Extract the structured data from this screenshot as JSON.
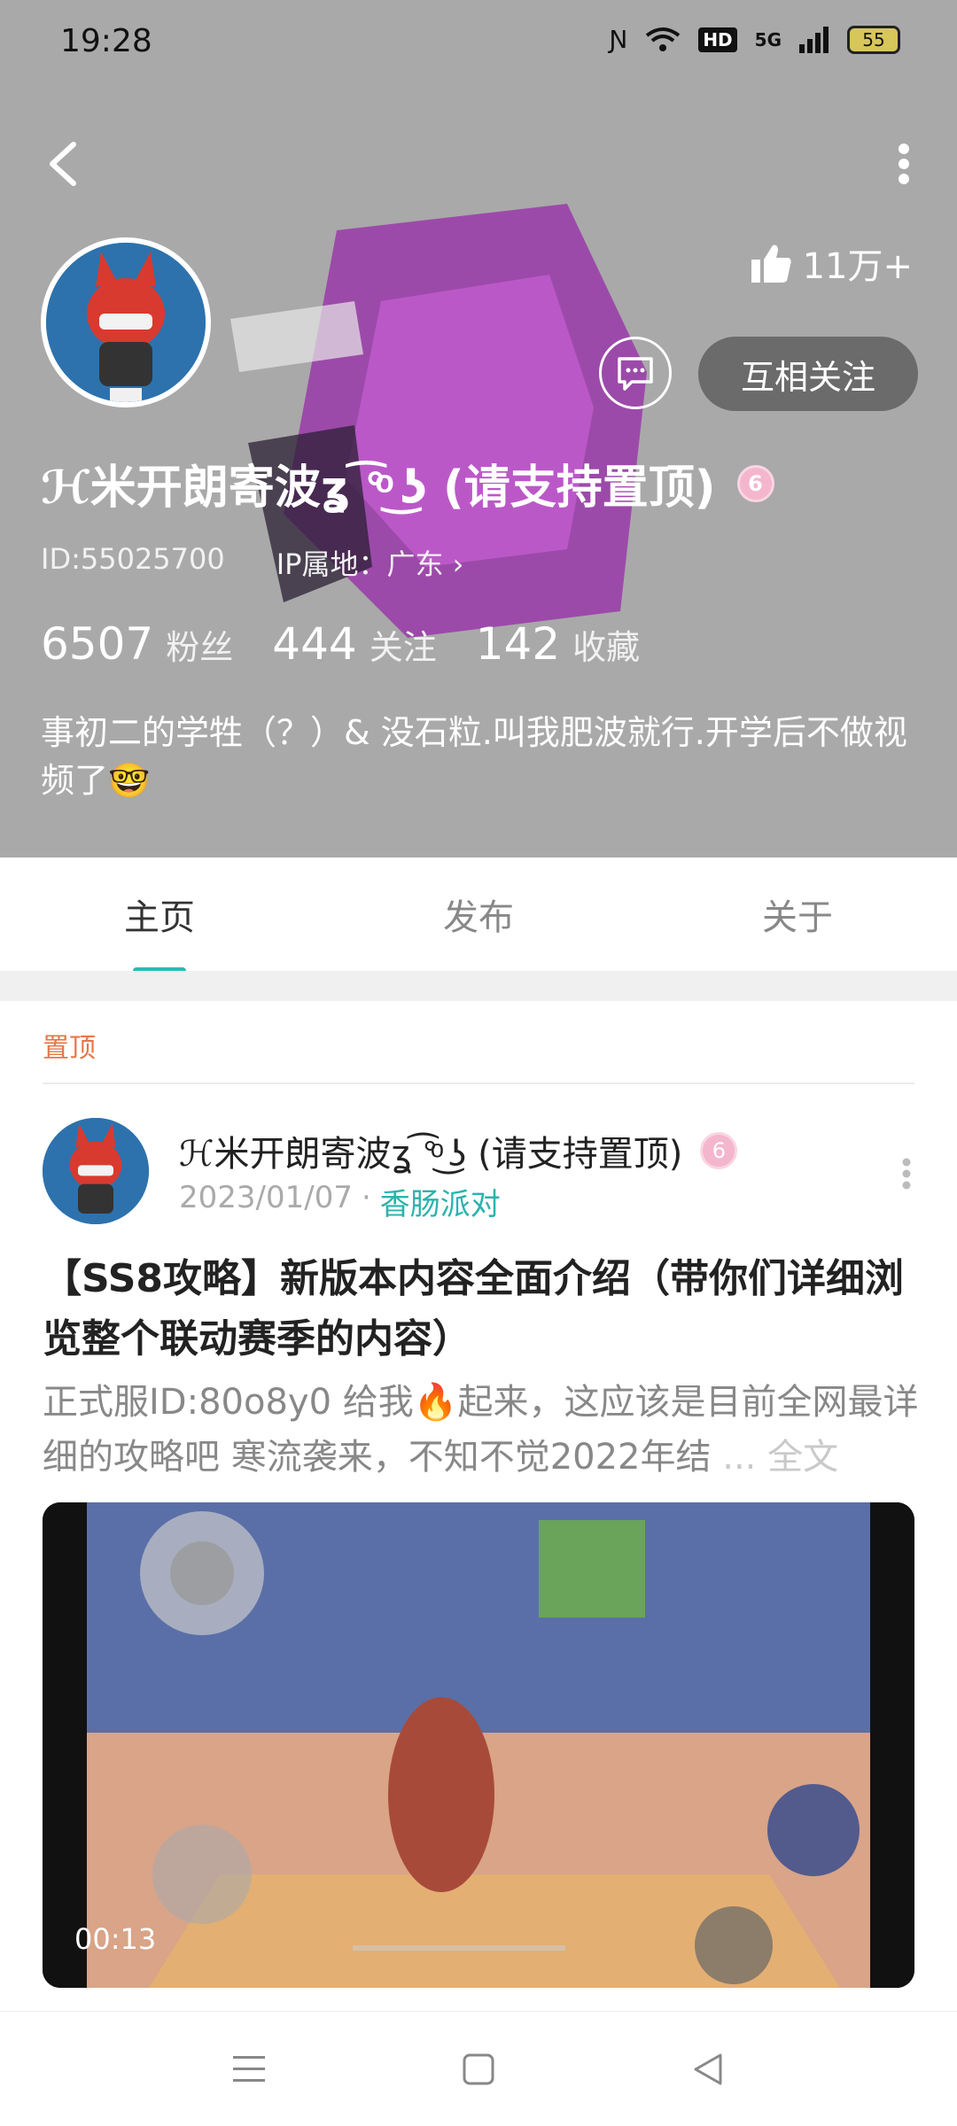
{
  "status_bar": {
    "time": "19:28",
    "network": "5G",
    "hd": "HD",
    "battery": "55"
  },
  "profile": {
    "likes": "11万+",
    "follow_button": "互相关注",
    "username": "ℋ米开朗寄波ʓ ͡°ͦ ͜ʖ (请支持置顶)",
    "level_badge": "6",
    "id_text": "ID:55025700",
    "ip_text": "IP属地：广东 ›",
    "stats": [
      {
        "num": "6507",
        "label": "粉丝"
      },
      {
        "num": "444",
        "label": "关注"
      },
      {
        "num": "142",
        "label": "收藏"
      }
    ],
    "bio": "事初二的学牲（？）& 没石粒.叫我肥波就行.开学后不做视频了🤓"
  },
  "tabs": [
    {
      "label": "主页",
      "active": true
    },
    {
      "label": "发布",
      "active": false
    },
    {
      "label": "关于",
      "active": false
    }
  ],
  "post": {
    "pin_label": "置顶",
    "author": "ℋ米开朗寄波ʓ ͡°ͦ ͜ʖ (请支持置顶)",
    "level_badge": "6",
    "date": "2023/01/07",
    "separator": "·",
    "topic": "香肠派对",
    "title": "【SS8攻略】新版本内容全面介绍（带你们详细浏览整个联动赛季的内容）",
    "excerpt": "正式服ID:80o8y0 给我🔥起来，这应该是目前全网最详细的攻略吧 寒流袭来，不知不觉2022年结",
    "fulltext_link": "... 全文",
    "video_time": "00:13"
  },
  "colors": {
    "header_bg": "#a9a9a9",
    "accent": "#27bdb7",
    "pin": "#e6764b",
    "follow_bg": "#6b6b6b"
  },
  "icons": [
    "back-arrow-icon",
    "more-vertical-icon",
    "thumbs-up-icon",
    "message-icon",
    "menu-icon",
    "home-square-icon",
    "back-triangle-icon"
  ]
}
